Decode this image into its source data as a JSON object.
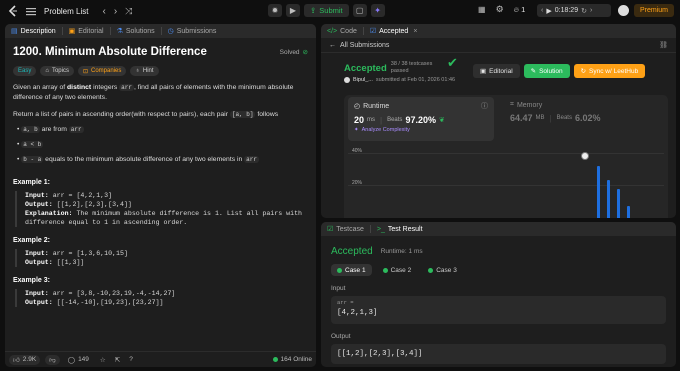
{
  "topbar": {
    "problem_list": "Problem List",
    "submit": "Submit",
    "streak": "1",
    "timer": "0:18:29",
    "premium": "Premium"
  },
  "left": {
    "tabs": [
      "Description",
      "Editorial",
      "Solutions",
      "Submissions"
    ],
    "title": "1200. Minimum Absolute Difference",
    "status": "Solved",
    "tags": {
      "difficulty": "Easy",
      "topics": "Topics",
      "companies": "Companies",
      "hint": "Hint"
    },
    "desc1_a": "Given an array of ",
    "desc1_b": "distinct",
    "desc1_c": " integers ",
    "desc1_code": "arr",
    "desc1_d": ", find all pairs of elements with the minimum absolute",
    "desc1_e": "difference of any two elements.",
    "desc2_a": "Return a list of pairs in ascending order(with respect to pairs), each pair ",
    "desc2_code": "[a, b]",
    "desc2_b": " follows",
    "bullets": [
      {
        "code": "a, b",
        "text": " are from ",
        "code2": "arr"
      },
      {
        "code": "a < b",
        "text": "",
        "code2": ""
      },
      {
        "code": "b - a",
        "text": " equals to the minimum absolute difference of any two elements in ",
        "code2": "arr"
      }
    ],
    "examples": [
      {
        "title": "Example 1:",
        "input": "arr = [4,2,1,3]",
        "output": "[[1,2],[2,3],[3,4]]",
        "explanation_1": "The minimum absolute difference is 1. List all pairs with",
        "explanation_2": "difference equal to 1 in ascending order."
      },
      {
        "title": "Example 2:",
        "input": "arr = [1,3,6,10,15]",
        "output": "[[1,3]]"
      },
      {
        "title": "Example 3:",
        "input": "arr = [3,8,-10,23,19,-4,-14,27]",
        "output": "[[-14,-10],[19,23],[23,27]]"
      }
    ],
    "labels": {
      "input": "Input:",
      "output": "Output:",
      "explanation": "Explanation:"
    },
    "footer": {
      "likes": "2.9K",
      "comments": "149",
      "online": "164 Online"
    }
  },
  "right_top": {
    "tabs": [
      "Code",
      "Accepted"
    ],
    "back": "All Submissions",
    "accepted": "Accepted",
    "testcases": "38 / 38 testcases",
    "passed": "passed",
    "user": "Bipul_...",
    "submitted": "submitted at Feb 01, 2026 01:46",
    "editorial": "Editorial",
    "solution": "Solution",
    "sync": "Sync w/ LeetHub",
    "runtime_label": "Runtime",
    "runtime_value": "20",
    "runtime_unit": "ms",
    "beats_label": "Beats",
    "runtime_beats": "97.20%",
    "analyze": "Analyze Complexity",
    "memory_label": "Memory",
    "memory_value": "64.47",
    "memory_unit": "MB",
    "memory_beats": "6.02%",
    "y_ticks": [
      "40%",
      "20%"
    ]
  },
  "chart_data": {
    "type": "bar",
    "values": [
      36,
      26,
      20,
      8
    ],
    "ylim": [
      0,
      45
    ],
    "y_ticks": [
      "40%",
      "20%"
    ],
    "color": "#1e6fe0"
  },
  "right_bottom": {
    "tabs": [
      "Testcase",
      "Test Result"
    ],
    "accepted": "Accepted",
    "runtime": "Runtime: 1 ms",
    "cases": [
      "Case 1",
      "Case 2",
      "Case 3"
    ],
    "input_label": "Input",
    "arr_label": "arr =",
    "arr_value": "[4,2,1,3]",
    "output_label": "Output",
    "output_value": "[[1,2],[2,3],[3,4]]"
  },
  "colors": {
    "accent_green": "#2cbb5d",
    "easy_teal": "#1cbaba",
    "companies_orange": "#ffa116",
    "blue": "#1e6fe0"
  }
}
